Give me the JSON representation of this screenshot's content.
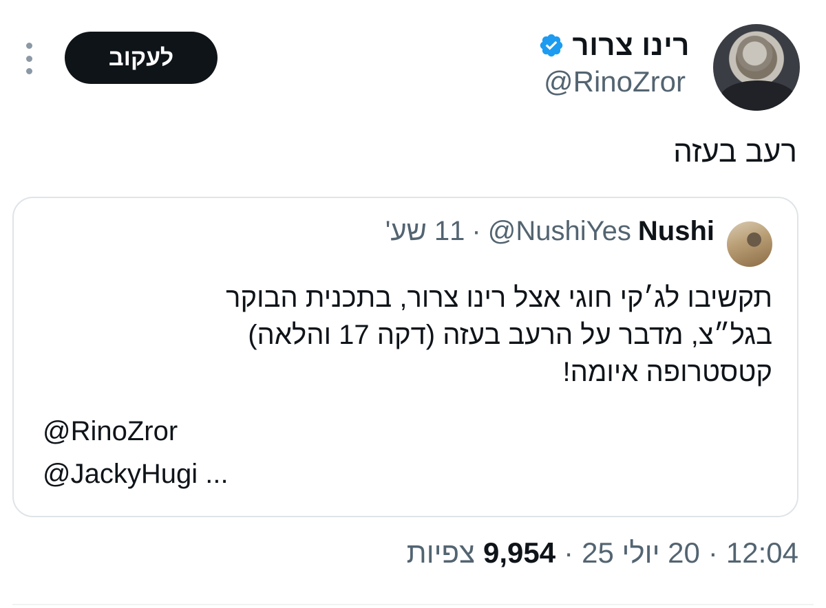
{
  "author": {
    "display_name": "רינו צרור",
    "handle": "@RinoZror",
    "verified": true,
    "verified_color": "#1d9bf0"
  },
  "actions": {
    "follow_label": "לעקוב",
    "more_icon": "more-vertical-icon"
  },
  "tweet": {
    "text": "רעב בעזה"
  },
  "quote": {
    "name": "Nushi",
    "handle": "@NushiYes",
    "separator": "·",
    "time": "11 שע'",
    "body_lines": [
      "תקשיבו לג׳קי חוגי אצל רינו צרור, בתכנית הבוקר",
      "בגל״צ, מדבר על הרעב בעזה (דקה 17 והלאה)",
      "קטסטרופה איומה!"
    ],
    "mentions": [
      "@RinoZror",
      "@JackyHugi ..."
    ]
  },
  "meta": {
    "time": "12:04",
    "date": "20 יולי 25",
    "separator": "·",
    "views_count": "9,954",
    "views_label": "צפיות"
  }
}
